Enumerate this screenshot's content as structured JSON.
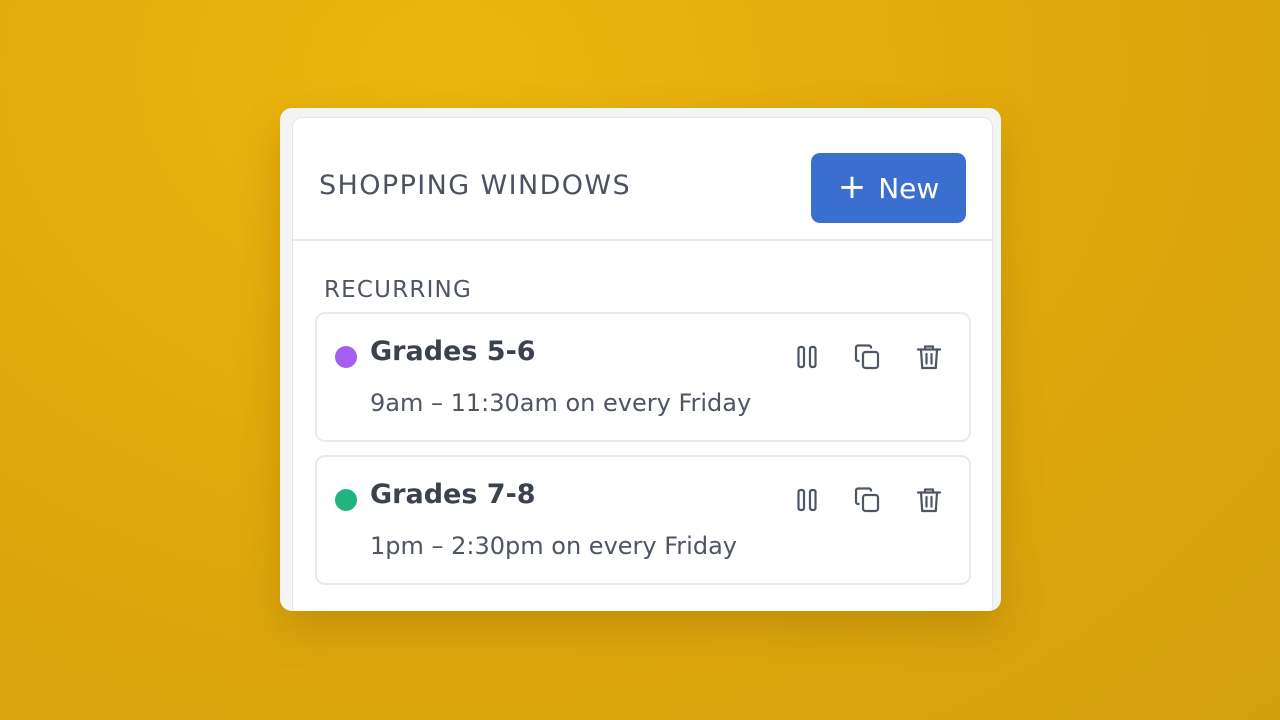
{
  "header": {
    "title": "SHOPPING WINDOWS",
    "new_button_label": "New",
    "new_button_icon": "plus-icon",
    "accent_color": "#3b6fcf"
  },
  "section": {
    "label": "RECURRING"
  },
  "windows": [
    {
      "name": "Grades 5-6",
      "schedule": "9am – 11:30am on every Friday",
      "dot_color": "#a45ef0",
      "actions": [
        "pause-icon",
        "duplicate-icon",
        "trash-icon"
      ]
    },
    {
      "name": "Grades 7-8",
      "schedule": "1pm – 2:30pm on every Friday",
      "dot_color": "#22b47e",
      "actions": [
        "pause-icon",
        "duplicate-icon",
        "trash-icon"
      ]
    }
  ]
}
